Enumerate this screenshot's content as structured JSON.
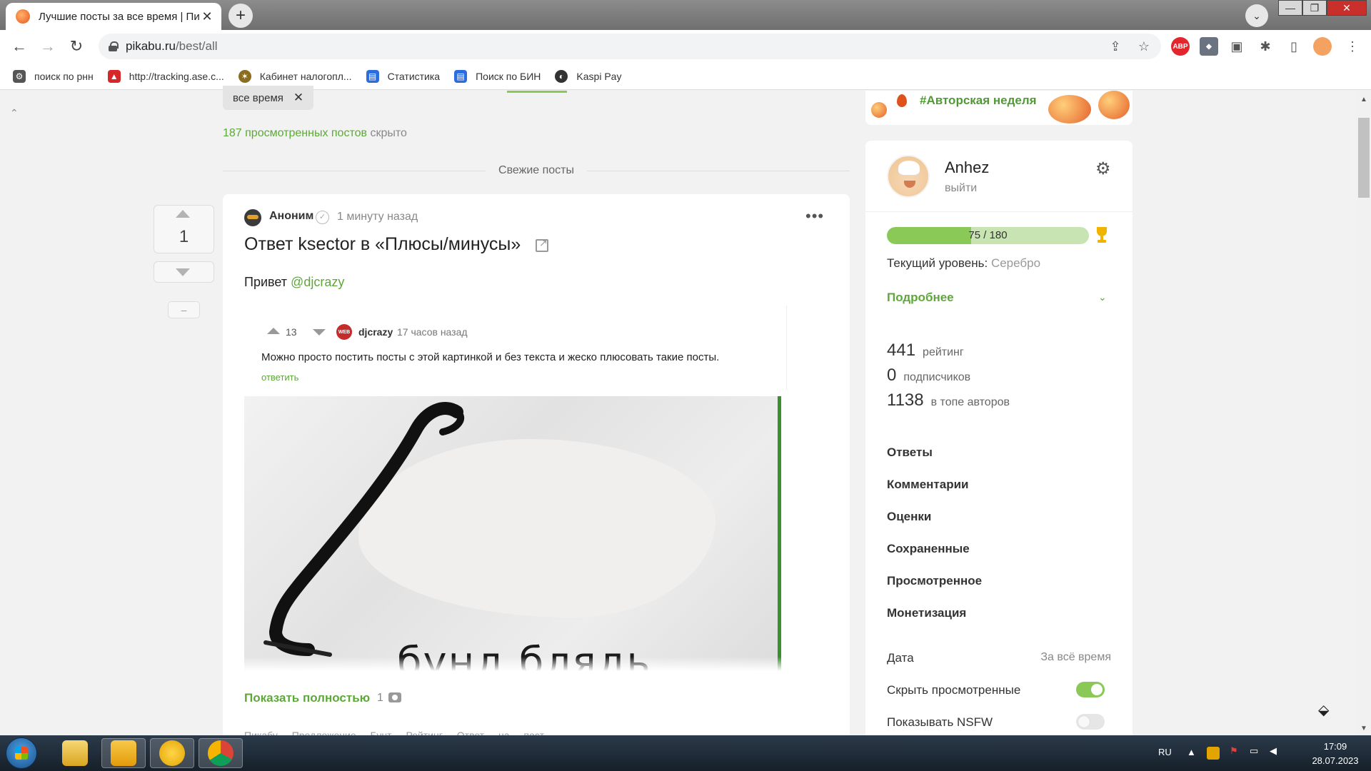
{
  "browser": {
    "tab_title": "Лучшие посты за все время | Пикабу",
    "url_host": "pikabu.ru",
    "url_path": "/best/all",
    "bookmarks": [
      {
        "label": "поиск по рнн",
        "icon": "gear-icon"
      },
      {
        "label": "http://tracking.ase.c...",
        "icon": "tracking-icon"
      },
      {
        "label": "Кабинет налогопл...",
        "icon": "tax-office-icon"
      },
      {
        "label": "Статистика",
        "icon": "stats-icon"
      },
      {
        "label": "Поиск по БИН",
        "icon": "search-bin-icon"
      },
      {
        "label": "Kaspi Pay",
        "icon": "kaspi-icon"
      }
    ],
    "extensions": {
      "adblock": "ABP"
    }
  },
  "feed": {
    "filter_chip": "все время",
    "hidden_count": "187 просмотренных постов",
    "hidden_suffix": "скрыто",
    "fresh_posts": "Свежие посты"
  },
  "post": {
    "votes": "1",
    "hide_label": "–",
    "author": "Аноним",
    "time": "1 минуту назад",
    "title": "Ответ ksector в «Плюсы/минусы»",
    "greeting": "Привет",
    "mention": "@djcrazy",
    "comment": {
      "votes": "13",
      "avatar_text": "WEB",
      "author": "djcrazy",
      "time": "17 часов назад",
      "text": "Можно просто постить посты с этой картинкой и без текста и жеско плюсовать такие посты.",
      "reply": "ответить"
    },
    "image_caption": "бунд блядь",
    "show_full": "Показать полностью",
    "images_count": "1",
    "tags": [
      "Пикабу",
      "Предложение",
      "Бунт",
      "Рейтинг",
      "Ответ на пост"
    ]
  },
  "sidebar": {
    "promo": "#Авторская неделя",
    "user_name": "Anhez",
    "logout": "выйти",
    "progress": {
      "current": 75,
      "max": 180,
      "label": "75 / 180"
    },
    "level_label": "Текущий уровень:",
    "level_value": "Серебро",
    "details": "Подробнее",
    "stats": [
      {
        "value": "441",
        "label": "рейтинг"
      },
      {
        "value": "0",
        "label": "подписчиков"
      },
      {
        "value": "1138",
        "label": "в топе авторов"
      }
    ],
    "menu": [
      "Ответы",
      "Комментарии",
      "Оценки",
      "Сохраненные",
      "Просмотренное",
      "Монетизация"
    ],
    "options": {
      "date_label": "Дата",
      "date_value": "За всё время",
      "hide_viewed": "Скрыть просмотренные",
      "hide_viewed_on": true,
      "show_nsfw": "Показывать NSFW",
      "show_nsfw_on": false
    }
  },
  "taskbar": {
    "lang": "RU",
    "time": "17:09",
    "date": "28.07.2023"
  },
  "colors": {
    "accent_green": "#5ea83a",
    "progress_fill": "#8ac858",
    "progress_track": "#c9e4b3"
  }
}
